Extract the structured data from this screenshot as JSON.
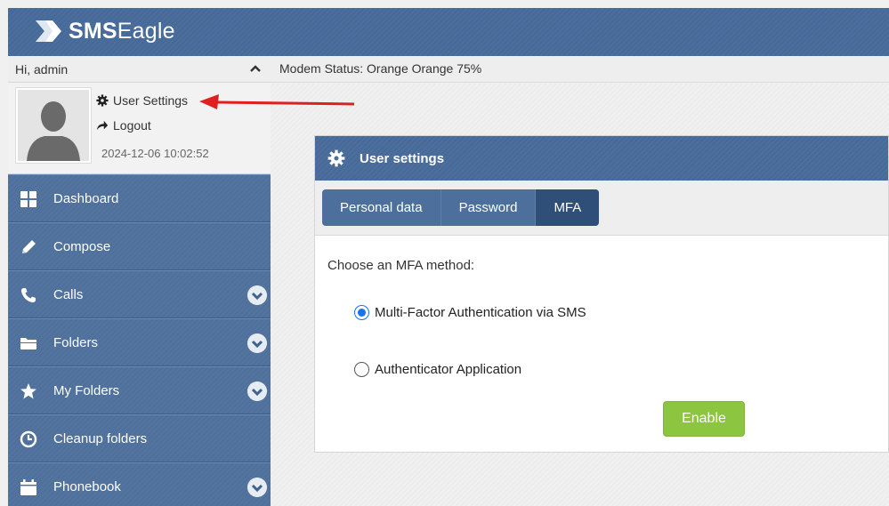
{
  "brand": {
    "bold": "SMS",
    "rest": "Eagle"
  },
  "user_panel": {
    "greeting": "Hi, admin",
    "settings_link": "User Settings",
    "logout_link": "Logout",
    "timestamp": "2024-12-06 10:02:52"
  },
  "nav": [
    {
      "label": "Dashboard",
      "icon": "grid-icon",
      "expandable": false
    },
    {
      "label": "Compose",
      "icon": "pencil-icon",
      "expandable": false
    },
    {
      "label": "Calls",
      "icon": "phone-icon",
      "expandable": true
    },
    {
      "label": "Folders",
      "icon": "folder-icon",
      "expandable": true
    },
    {
      "label": "My Folders",
      "icon": "star-icon",
      "expandable": true
    },
    {
      "label": "Cleanup folders",
      "icon": "clock-icon",
      "expandable": false
    },
    {
      "label": "Phonebook",
      "icon": "calendar-icon",
      "expandable": true
    }
  ],
  "status_bar": {
    "text": "Modem Status: Orange Orange 75%"
  },
  "panel": {
    "title": "User settings",
    "tabs": [
      {
        "label": "Personal data",
        "active": false
      },
      {
        "label": "Password",
        "active": false
      },
      {
        "label": "MFA",
        "active": true
      }
    ],
    "prompt": "Choose an MFA method:",
    "options": [
      {
        "label": "Multi-Factor Authentication via SMS",
        "selected": true
      },
      {
        "label": "Authenticator Application",
        "selected": false
      }
    ],
    "enable_label": "Enable"
  },
  "colors": {
    "header_blue": "#4b6f9b",
    "active_tab": "#2f4f79",
    "enable_green": "#8cc53f",
    "annotation_red": "#e02020",
    "radio_blue": "#1a73e8"
  }
}
